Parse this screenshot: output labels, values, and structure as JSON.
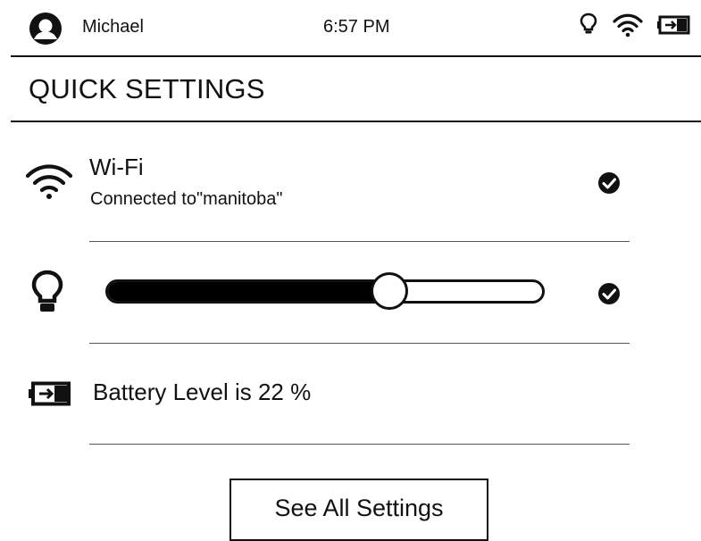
{
  "status_bar": {
    "user_name": "Michael",
    "time": "6:57 PM",
    "icons": [
      "avatar-icon",
      "lightbulb-icon",
      "wifi-icon",
      "battery-charging-icon"
    ]
  },
  "title": "QUICK SETTINGS",
  "wifi": {
    "label": "Wi-Fi",
    "status": "Connected to\"manitoba\"",
    "enabled": true,
    "icon": "wifi-icon"
  },
  "light": {
    "icon": "lightbulb-icon",
    "level": 0.66,
    "enabled": true
  },
  "battery": {
    "icon": "battery-charging-icon",
    "text": "Battery Level is 22 %"
  },
  "button": {
    "label": "See All Settings"
  },
  "colors": {
    "foreground": "#111111",
    "background": "#ffffff"
  }
}
